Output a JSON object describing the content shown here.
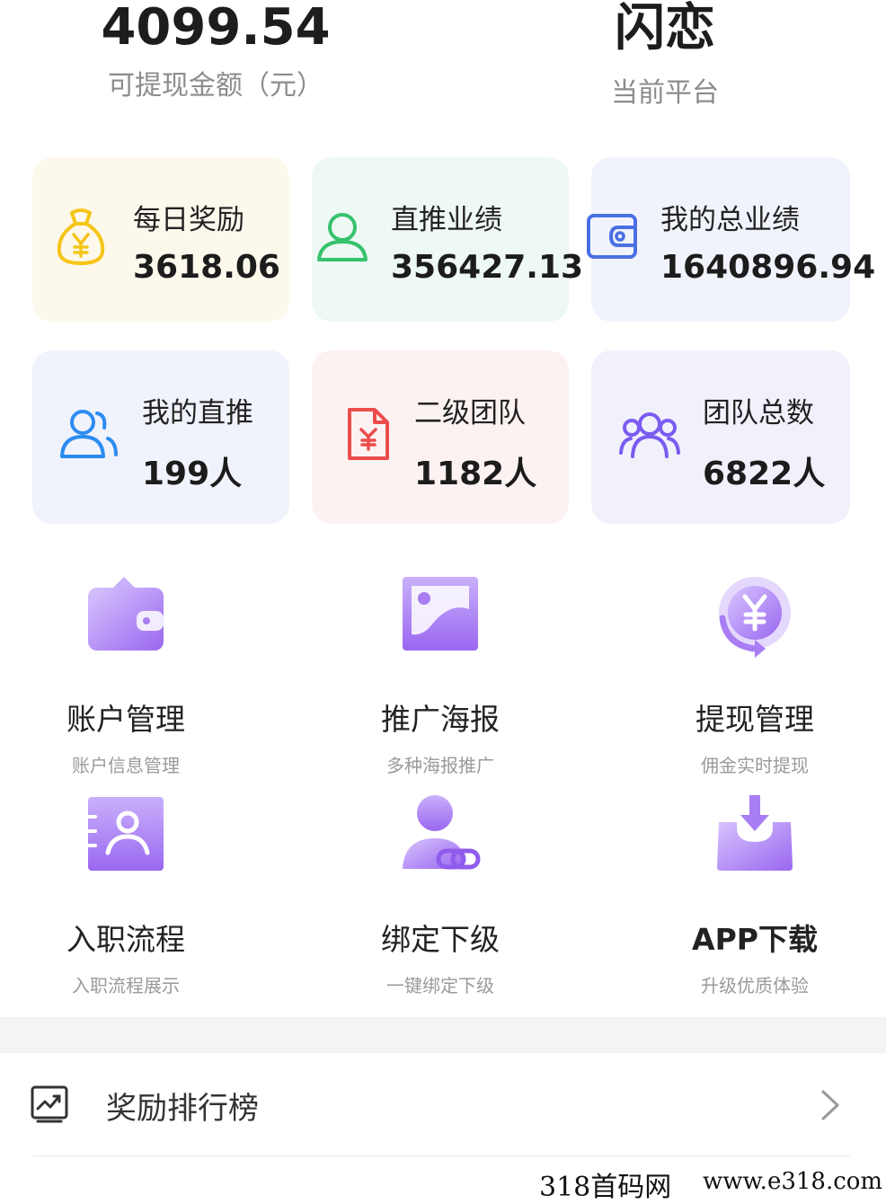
{
  "top": {
    "balance_value": "4099.54",
    "balance_label": "可提现金额（元）",
    "platform_value": "闪恋",
    "platform_label": "当前平台"
  },
  "cards": [
    {
      "label": "每日奖励",
      "value": "3618.06",
      "icon": "money-bag-icon",
      "bg": "#fdf8ec",
      "icon_color": "#f5c518"
    },
    {
      "label": "直推业绩",
      "value": "356427.13",
      "icon": "user-outline-icon",
      "bg": "#eef8f5",
      "icon_color": "#37c26d"
    },
    {
      "label": "我的总业绩",
      "value": "1640896.94",
      "icon": "wallet-icon",
      "bg": "#f1f3fc",
      "icon_color": "#4a6fe3"
    },
    {
      "label": "我的直推",
      "value": "199人",
      "icon": "users-pair-icon",
      "bg": "#f1f3fc",
      "icon_color": "#2d8cf0"
    },
    {
      "label": "二级团队",
      "value": "1182人",
      "icon": "yuan-document-icon",
      "bg": "#fdf2f2",
      "icon_color": "#ec4c4c"
    },
    {
      "label": "团队总数",
      "value": "6822人",
      "icon": "team-group-icon",
      "bg": "#f1f1fc",
      "icon_color": "#7b5cf0"
    }
  ],
  "features": [
    {
      "title": "账户管理",
      "subtitle": "账户信息管理",
      "icon": "purse-icon"
    },
    {
      "title": "推广海报",
      "subtitle": "多种海报推广",
      "icon": "poster-image-icon"
    },
    {
      "title": "提现管理",
      "subtitle": "佣金实时提现",
      "icon": "yuan-coin-refresh-icon"
    },
    {
      "title": "入职流程",
      "subtitle": "入职流程展示",
      "icon": "id-card-icon"
    },
    {
      "title": "绑定下级",
      "subtitle": "一键绑定下级",
      "icon": "user-link-icon"
    },
    {
      "title": "APP下载",
      "subtitle": "升级优质体验",
      "icon": "download-tray-icon"
    }
  ],
  "rank": {
    "label": "奖励排行榜",
    "icon": "chart-trend-icon"
  },
  "watermark": {
    "left": "318首码网",
    "right": "www.e318.com"
  },
  "colors": {
    "accent_purple": "#9d6bf2",
    "accent_purple_light": "#cbb2fb"
  }
}
